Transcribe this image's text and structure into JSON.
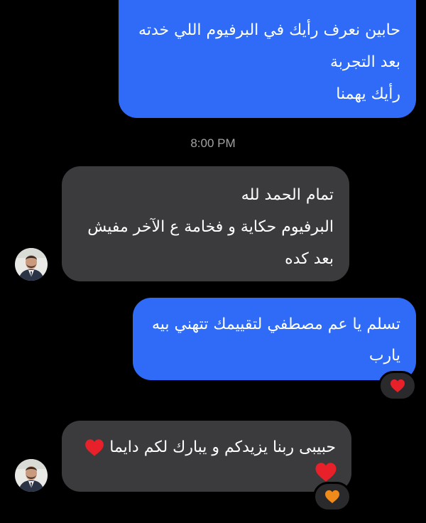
{
  "messages": [
    {
      "lines": [
        "حابين نعرف رأيك في البرفيوم اللي خدته",
        "بعد التجربة",
        "رأيك يهمنا"
      ]
    },
    {
      "lines": [
        "تمام الحمد لله",
        "البرفيوم حكاية و فخامة ع الآخر مفيش",
        "بعد كده"
      ]
    },
    {
      "lines": [
        "تسلم يا عم مصطفي لتقييمك تتهني بيه",
        "يارب"
      ],
      "reaction": "red-heart-icon"
    },
    {
      "lines": [
        "حبيبى ربنا يزيدكم و يبارك لكم دايما"
      ],
      "reaction": "orange-heart-icon"
    }
  ],
  "timestamp": "8:00 PM",
  "colors": {
    "background": "#000000",
    "sent_bubble": "#2f6bf6",
    "received_bubble": "#3b3b3d",
    "timestamp": "#a2a2a6",
    "red_heart": "#e8202a",
    "orange_heart": "#f08a1a"
  }
}
